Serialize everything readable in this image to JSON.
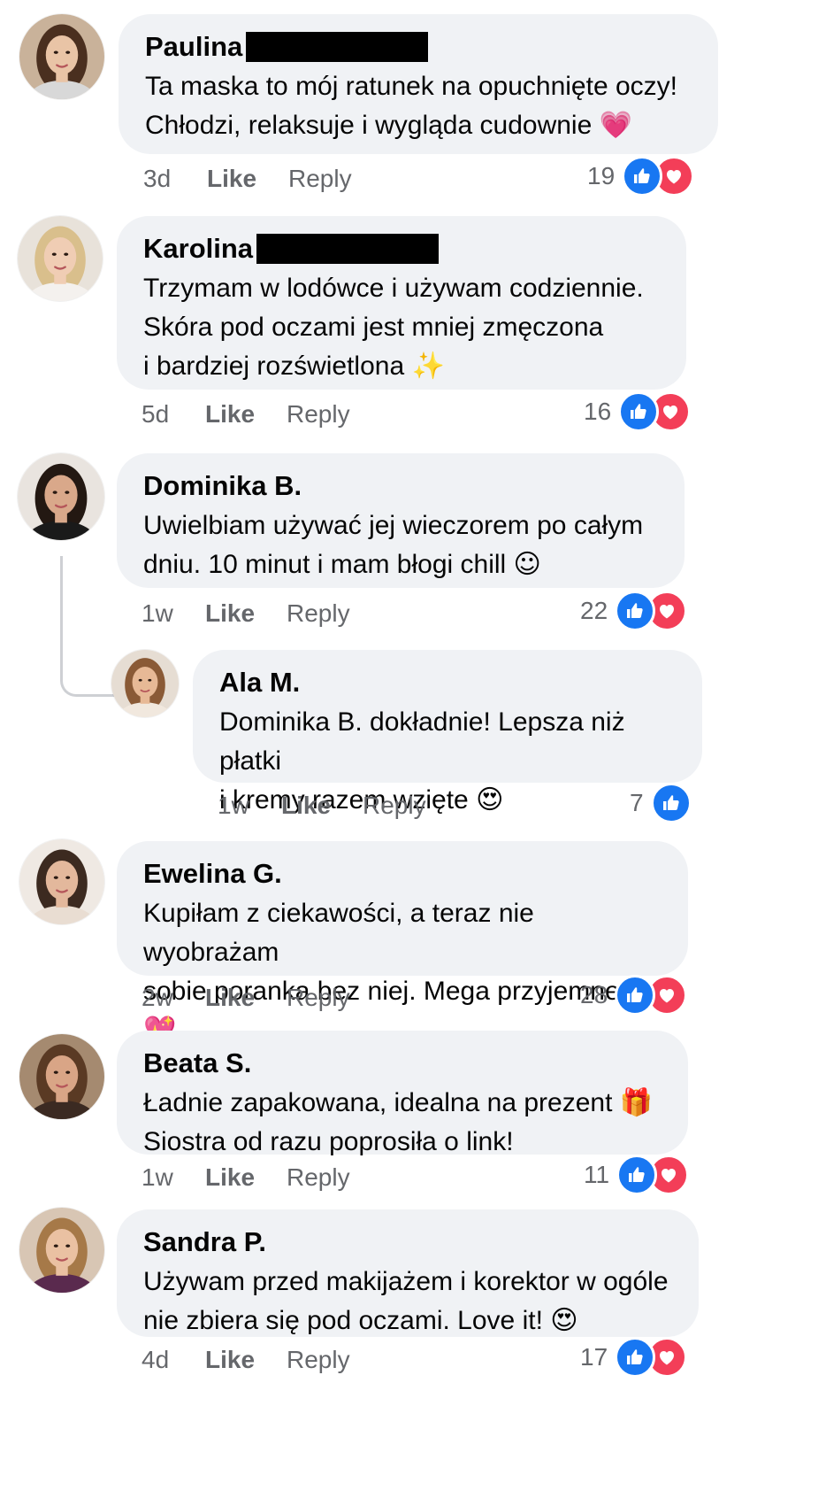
{
  "comments": [
    {
      "name": "Paulina",
      "redacted": true,
      "text": "Ta maska to mój ratunek na opuchnięte oczy!\nChłodzi, relaksuje i wygląda cudownie",
      "emoji": "💗",
      "time": "3d",
      "like_label": "Like",
      "reply_label": "Reply",
      "reactions": "19",
      "reaction_types": [
        "like",
        "love"
      ],
      "avatar_colors": {
        "bg": "#c9b29a",
        "hair": "#4a2f1f",
        "skin": "#e9c4a6",
        "top": "#d8d8d8"
      }
    },
    {
      "name": "Karolina",
      "redacted": true,
      "text": "Trzymam w lodówce i używam codziennie.\nSkóra pod oczami jest mniej zmęczona\ni bardziej rozświetlona",
      "emoji": "✨",
      "time": "5d",
      "like_label": "Like",
      "reply_label": "Reply",
      "reactions": "16",
      "reaction_types": [
        "like",
        "love"
      ],
      "avatar_colors": {
        "bg": "#e8e2da",
        "hair": "#d9bf8c",
        "skin": "#f0cdb4",
        "top": "#f4f1ee"
      }
    },
    {
      "name": "Dominika B.",
      "redacted": false,
      "text": "Uwielbiam używać jej wieczorem po całym\ndniu. 10 minut i mam błogi chill",
      "emoji": "☺",
      "time": "1w",
      "like_label": "Like",
      "reply_label": "Reply",
      "reactions": "22",
      "reaction_types": [
        "like",
        "love"
      ],
      "avatar_colors": {
        "bg": "#e9e4df",
        "hair": "#231812",
        "skin": "#d9a88a",
        "top": "#1a1a1a"
      }
    },
    {
      "name": "Ala M.",
      "redacted": false,
      "text": "Dominika B. dokładnie! Lepsza niż płatki\ni kremy razem wzięte",
      "emoji": "😍",
      "time": "1w",
      "like_label": "Like",
      "reply_label": "Reply",
      "reactions": "7",
      "reaction_types": [
        "like"
      ],
      "avatar_colors": {
        "bg": "#e6ddd3",
        "hair": "#8a5a36",
        "skin": "#e7b996",
        "top": "#f1e8de"
      }
    },
    {
      "name": "Ewelina G.",
      "redacted": false,
      "text": "Kupiłam z ciekawości, a teraz nie wyobrażam\nsobie poranka bez niej. Mega przyjemne!",
      "emoji": "💖",
      "time": "2w",
      "like_label": "Like",
      "reply_label": "Reply",
      "reactions": "28",
      "reaction_types": [
        "like",
        "love"
      ],
      "avatar_colors": {
        "bg": "#efe9e3",
        "hair": "#3c2a20",
        "skin": "#e3b89c",
        "top": "#e9ddd2"
      }
    },
    {
      "name": "Beata S.",
      "redacted": false,
      "text": "Ładnie zapakowana, idealna na prezent\nSiostra od razu poprosiła o link!",
      "emoji": "🎁",
      "time": "1w",
      "like_label": "Like",
      "reply_label": "Reply",
      "reactions": "11",
      "reaction_types": [
        "like",
        "love"
      ],
      "avatar_colors": {
        "bg": "#a58a70",
        "hair": "#5a3a24",
        "skin": "#d9a586",
        "top": "#3b2a22"
      }
    },
    {
      "name": "Sandra P.",
      "redacted": false,
      "text": "Używam przed makijażem i korektor w ogóle\nnie zbiera się pod oczami. Love it!",
      "emoji": "😍",
      "time": "4d",
      "like_label": "Like",
      "reply_label": "Reply",
      "reactions": "17",
      "reaction_types": [
        "like",
        "love"
      ],
      "avatar_colors": {
        "bg": "#d8c6b4",
        "hair": "#a67948",
        "skin": "#eac1a2",
        "top": "#5a2a4e"
      }
    }
  ]
}
